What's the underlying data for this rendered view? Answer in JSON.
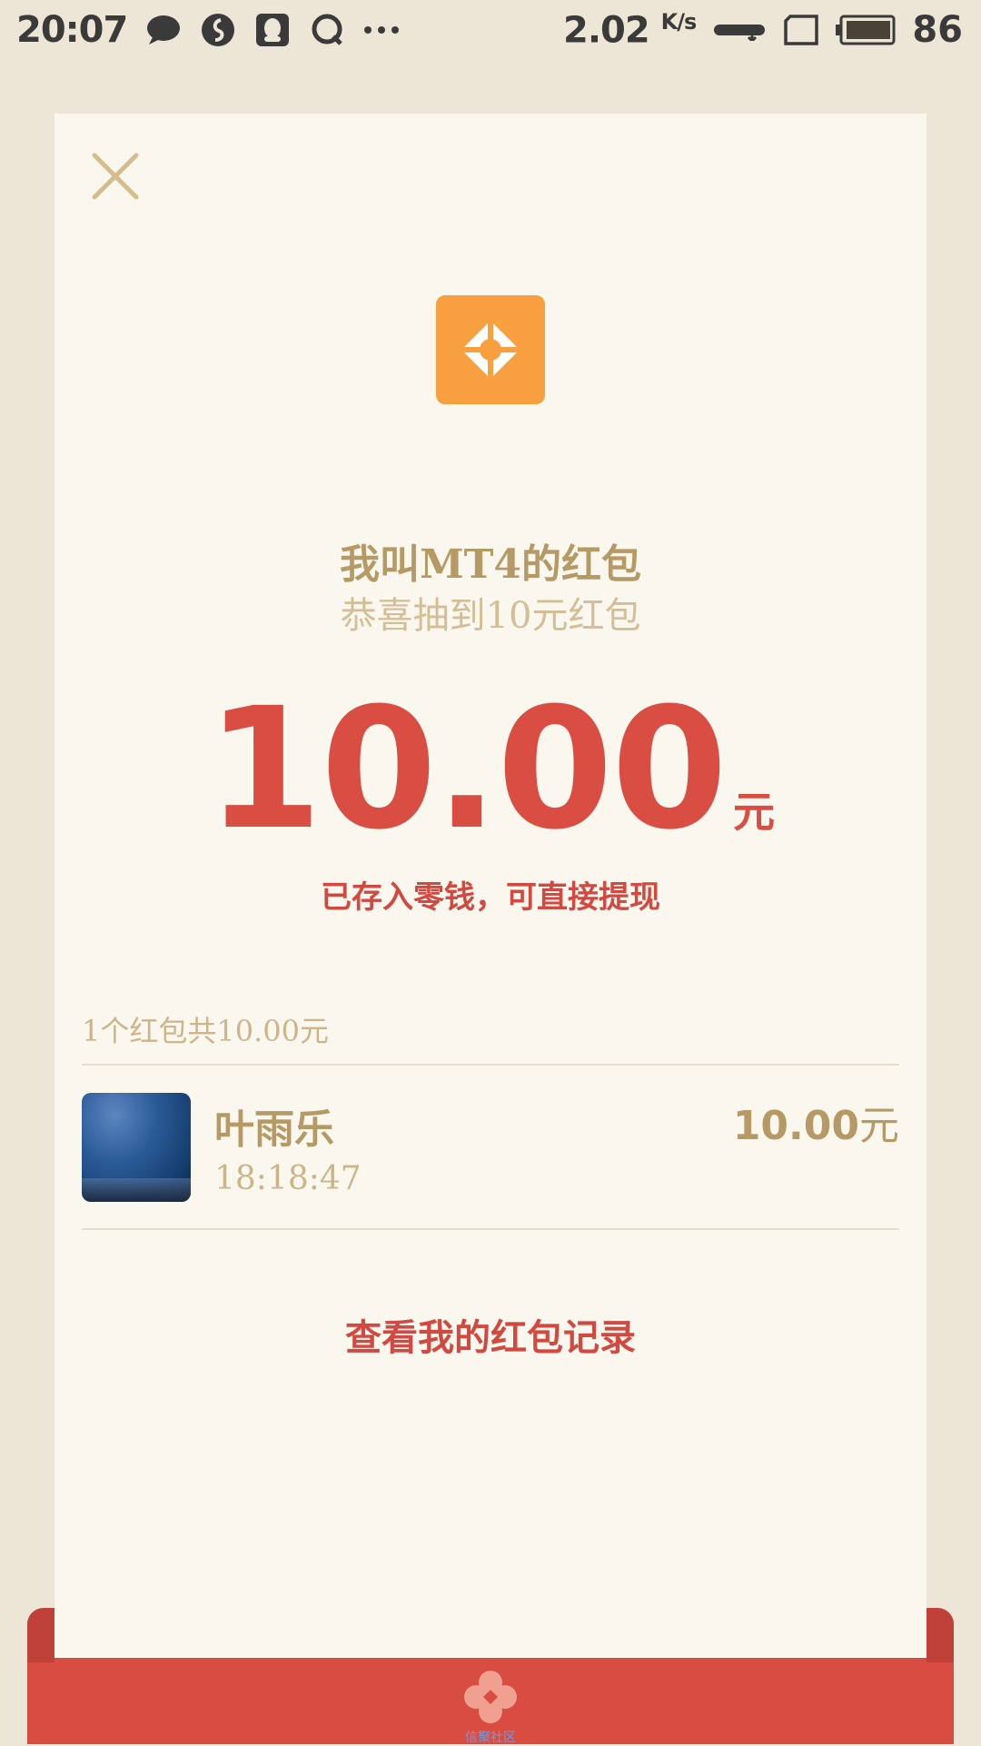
{
  "status_bar": {
    "time": "20:07",
    "speed_value": "2.02",
    "speed_unit": "K/s",
    "battery": "86"
  },
  "card": {
    "title": "我叫MT4的红包",
    "subtitle": "恭喜抽到10元红包",
    "amount": "10.00",
    "amount_unit": "元",
    "deposit_note": "已存入零钱，可直接提现",
    "summary": "1个红包共10.00元",
    "receiver": {
      "name": "叶雨乐",
      "time": "18:18:47",
      "amount": "10.00",
      "amount_unit": "元"
    },
    "records_link": "查看我的红包记录"
  },
  "envelope": {
    "caption": "信聚社区"
  },
  "colors": {
    "page_bg": "#ede6d6",
    "card_bg": "#faf7ef",
    "accent_red": "#d94d43",
    "gold_text": "#b59a66",
    "app_icon_orange": "#f89f40"
  },
  "icons": [
    "message-icon",
    "app-s-icon",
    "qq-icon",
    "q-icon",
    "more-dots-icon",
    "signal-icon",
    "sim-icon",
    "battery-icon",
    "close-icon",
    "app-logo-icon",
    "envelope-logo-icon"
  ]
}
